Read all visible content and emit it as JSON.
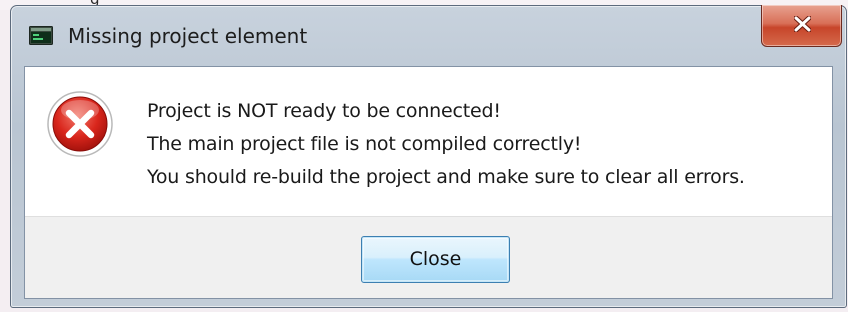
{
  "background": {
    "partial_text": "g"
  },
  "dialog": {
    "title": "Missing project element",
    "app_icon": "terminal-icon",
    "titlebar_close_icon": "close-icon",
    "error_icon": "error-icon",
    "message_lines": [
      "Project is NOT ready to be connected!",
      "The main project file is not compiled correctly!",
      "You should re-build the project and make sure to clear all errors."
    ],
    "close_button_label": "Close"
  },
  "colors": {
    "error_red": "#d9261c",
    "titlebar_close_red": "#c7452a",
    "button_blue": "#3c7fb1"
  }
}
